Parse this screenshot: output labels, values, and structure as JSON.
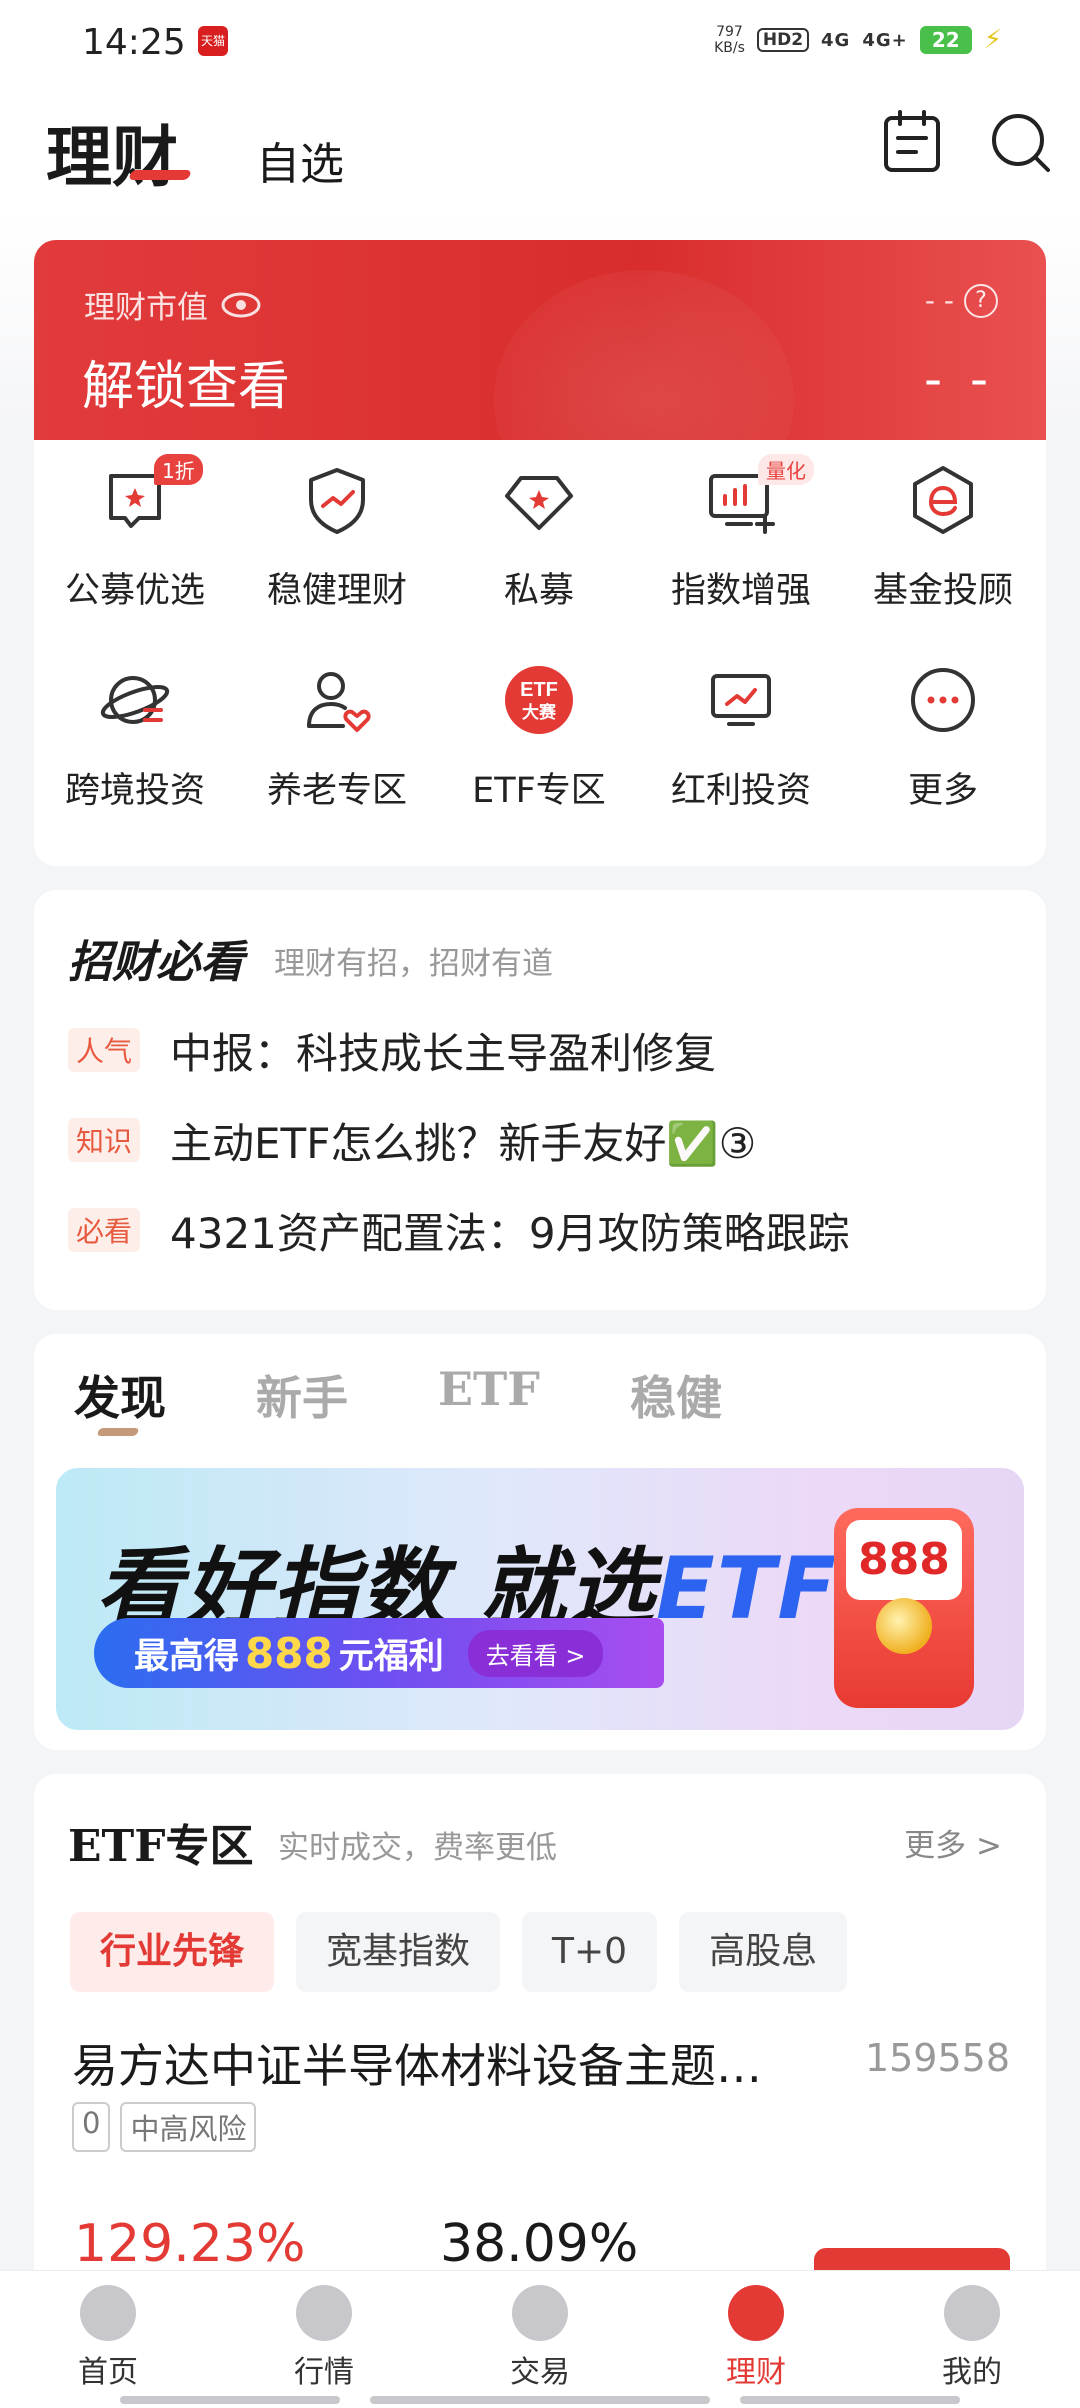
{
  "status": {
    "time": "14:25",
    "app_badge": "天猫",
    "speed": "797",
    "speed_unit": "KB/s",
    "hd_label": "HD2",
    "net1": "4G",
    "net2": "4G+",
    "battery": "22"
  },
  "header": {
    "title": "理财",
    "tab": "自选"
  },
  "assets": {
    "label": "理财市值",
    "value": "解锁查看",
    "dash_small": "- -",
    "dash_big": "- -",
    "help": "?"
  },
  "menu": [
    {
      "label": "公募优选",
      "badge": "1折",
      "icon": "chat-bookmark-icon"
    },
    {
      "label": "稳健理财",
      "badge": "",
      "icon": "shield-chart-icon"
    },
    {
      "label": "私募",
      "badge": "",
      "icon": "diamond-icon"
    },
    {
      "label": "指数增强",
      "badge": "量化",
      "icon": "monitor-chart-icon"
    },
    {
      "label": "基金投顾",
      "badge": "",
      "icon": "e-hexagon-icon"
    },
    {
      "label": "跨境投资",
      "badge": "",
      "icon": "planet-icon"
    },
    {
      "label": "养老专区",
      "badge": "",
      "icon": "person-heart-icon"
    },
    {
      "label": "ETF专区",
      "badge": "",
      "icon": "etf-contest-icon",
      "icon_text": "ETF大赛"
    },
    {
      "label": "红利投资",
      "badge": "",
      "icon": "screen-chart-icon"
    },
    {
      "label": "更多",
      "badge": "",
      "icon": "more-dots-icon"
    }
  ],
  "must_read": {
    "title": "招财必看",
    "subtitle": "理财有招，招财有道",
    "items": [
      {
        "tag": "人气",
        "text": "中报：科技成长主导盈利修复"
      },
      {
        "tag": "知识",
        "text": "主动ETF怎么挑？新手友好✅③"
      },
      {
        "tag": "必看",
        "text": "4321资产配置法：9月攻防策略跟踪"
      }
    ]
  },
  "discover": {
    "tabs": [
      "发现",
      "新手",
      "ETF",
      "稳健"
    ],
    "banner": {
      "title_a": "看好指数 就选",
      "title_b": "ETF",
      "pill_prefix": "最高得",
      "pill_num": "888",
      "pill_suffix": "元福利",
      "go": "去看看 >",
      "envelope_num": "888"
    }
  },
  "etf_zone": {
    "title": "ETF专区",
    "subtitle": "实时成交，费率更低",
    "more": "更多 >",
    "chips": [
      "行业先锋",
      "宽基指数",
      "T+0",
      "高股息"
    ],
    "fund_name": "易方达中证半导体材料设备主题…",
    "fund_code": "159558",
    "tags": [
      "0",
      "中高风险"
    ],
    "stat1": "129.23%",
    "stat2": "38.09%"
  },
  "bottom_nav": [
    {
      "label": "首页",
      "icon": "home-icon",
      "active": false
    },
    {
      "label": "行情",
      "icon": "market-trend-icon",
      "active": false
    },
    {
      "label": "交易",
      "icon": "exchange-icon",
      "active": false
    },
    {
      "label": "理财",
      "icon": "wealth-diamond-icon",
      "active": true
    },
    {
      "label": "我的",
      "icon": "profile-cow-icon",
      "active": false
    }
  ],
  "colors": {
    "brand_red": "#e33a35",
    "banner_blue": "#2c63f1"
  }
}
